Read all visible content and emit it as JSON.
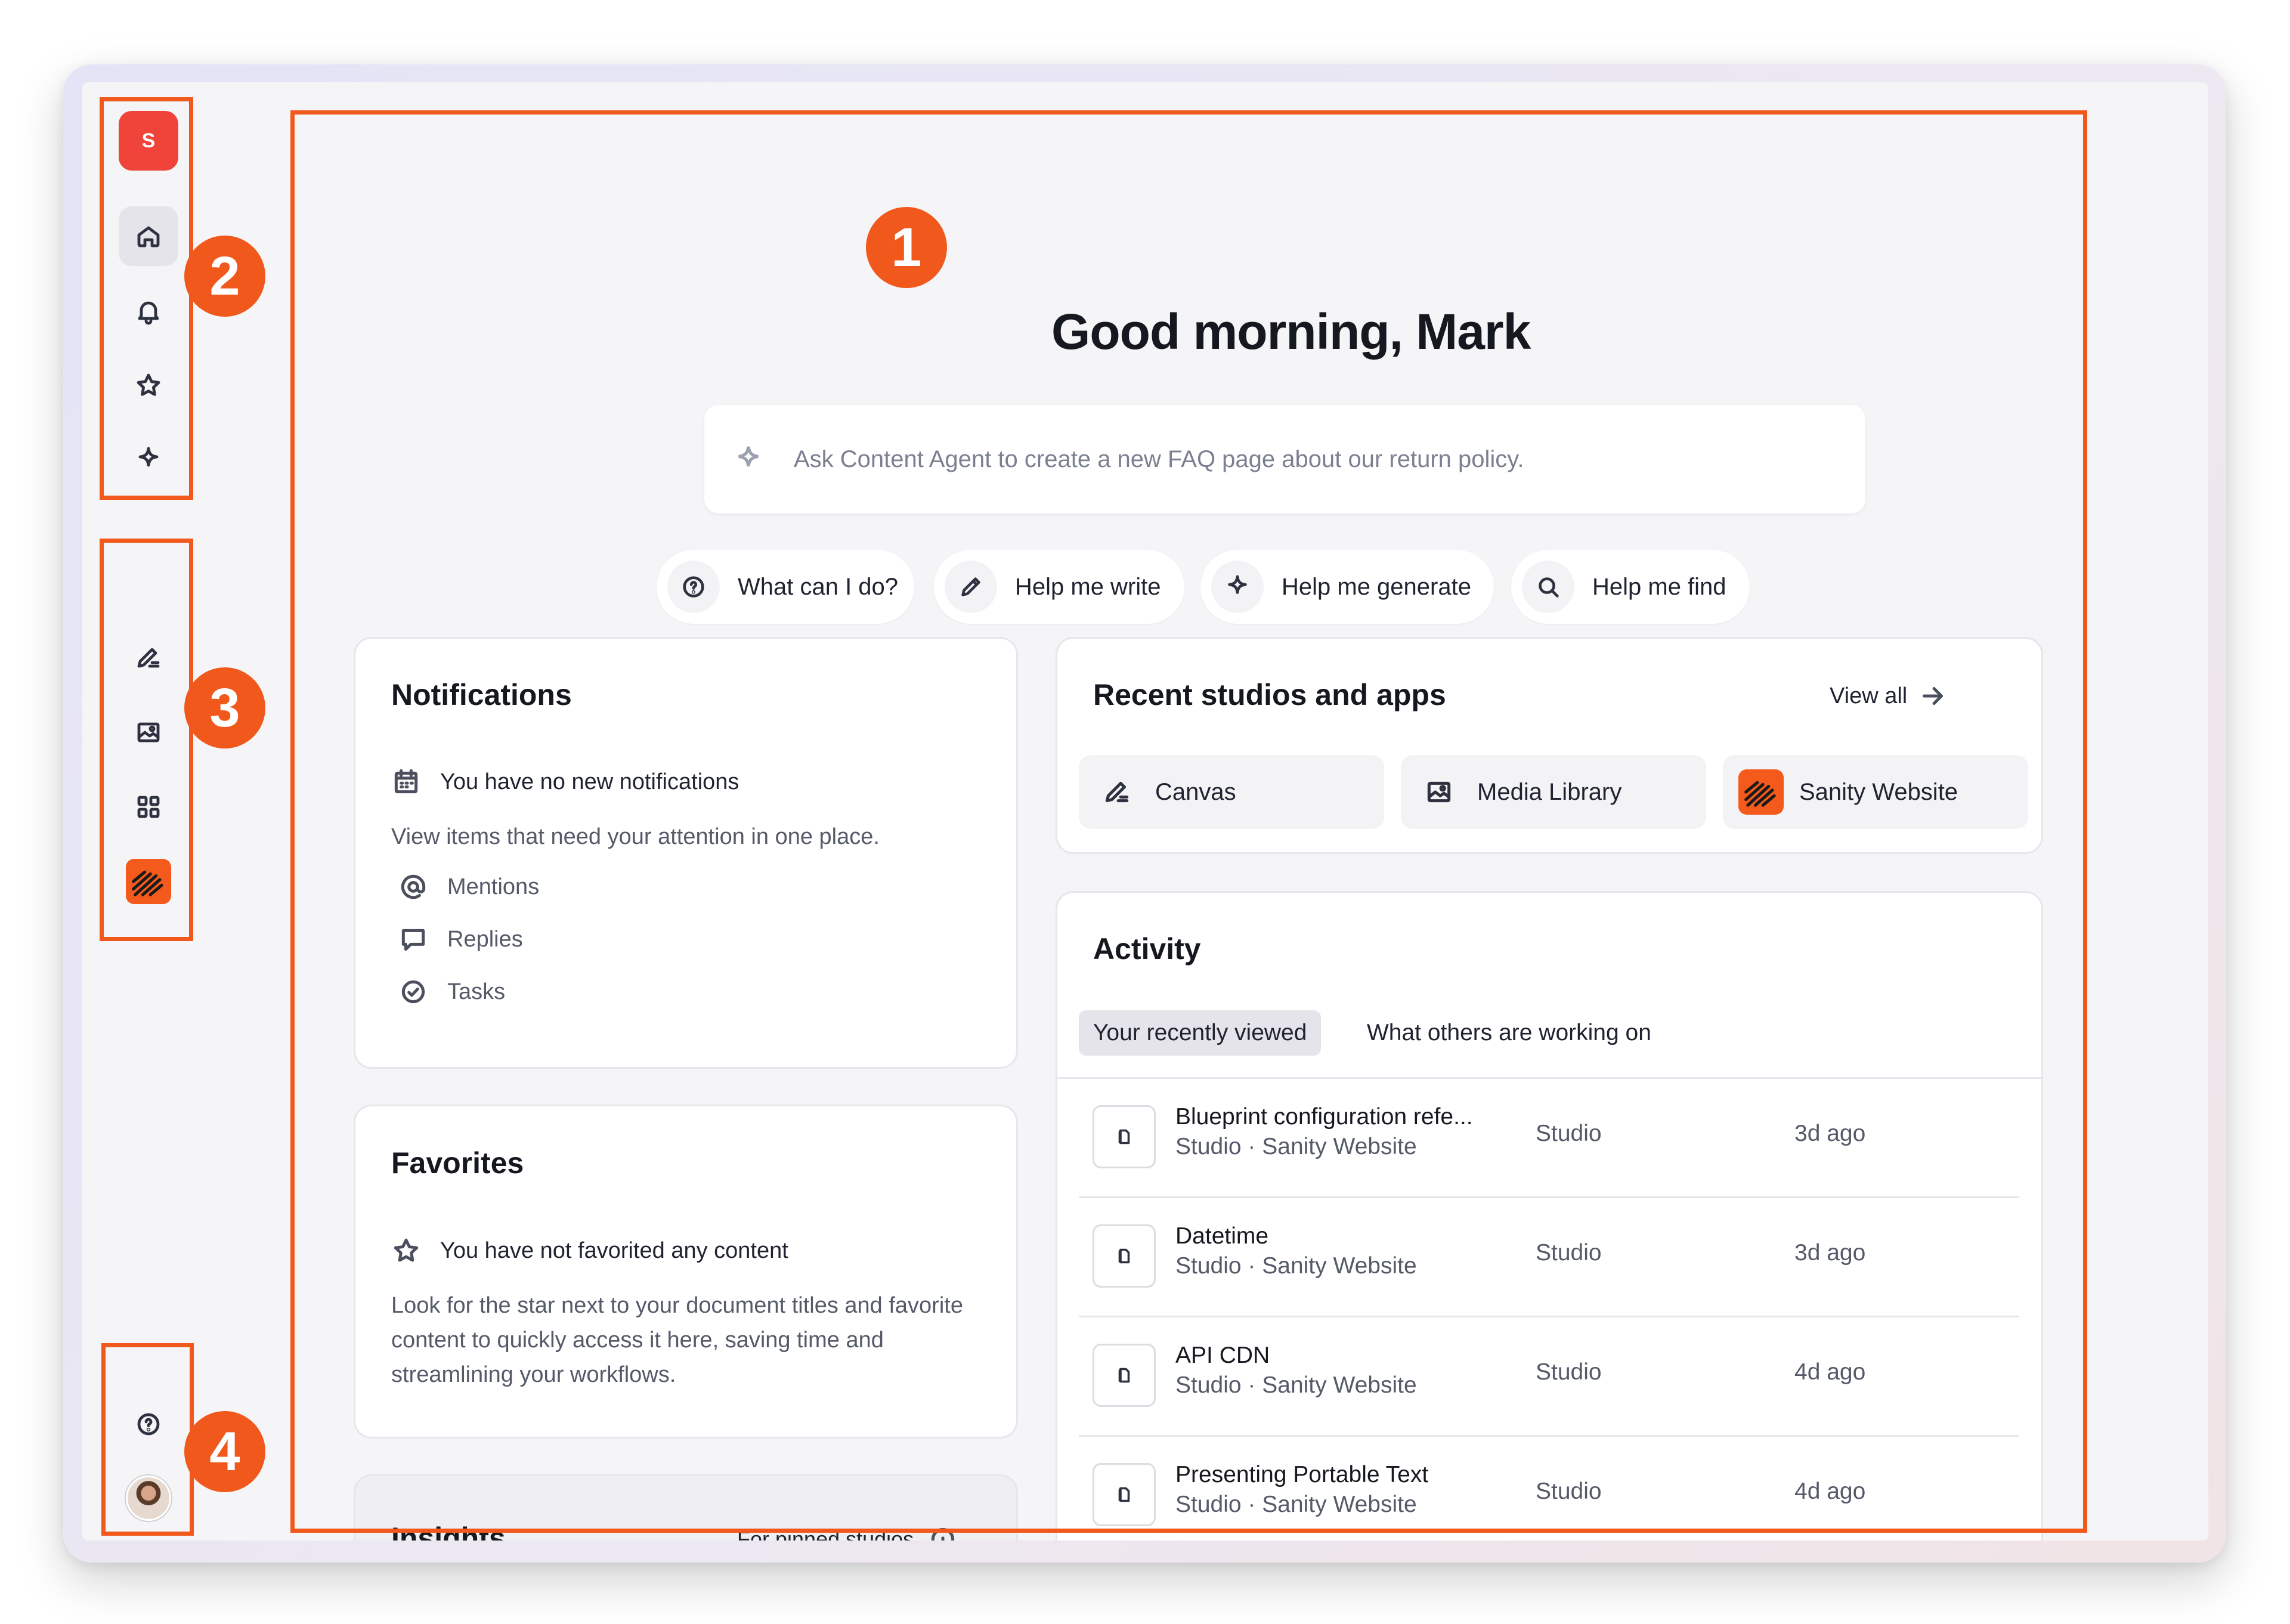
{
  "sidebar": {
    "logo_letter": "S",
    "nav_icons": [
      "home-icon",
      "bell-icon",
      "star-icon",
      "sparkle-icon"
    ],
    "app_icons": [
      "canvas-icon",
      "media-library-icon",
      "apps-grid-icon",
      "sanity-website-icon"
    ],
    "bottom_icons": [
      "help-icon",
      "avatar"
    ]
  },
  "annotations": {
    "badge_1": "1",
    "badge_2": "2",
    "badge_3": "3",
    "badge_4": "4",
    "accent_color": "#f0581c"
  },
  "main": {
    "greeting": "Good morning, Mark",
    "prompt_placeholder": "Ask Content Agent to create a new FAQ page about our return policy.",
    "chips": [
      {
        "label": "What can I do?",
        "icon": "question-icon"
      },
      {
        "label": "Help me write",
        "icon": "pencil-icon"
      },
      {
        "label": "Help me generate",
        "icon": "sparkle-icon"
      },
      {
        "label": "Help me find",
        "icon": "search-icon"
      }
    ]
  },
  "notifications": {
    "title": "Notifications",
    "empty_text": "You have no new notifications",
    "description": "View items that need your attention in one place.",
    "items": [
      "Mentions",
      "Replies",
      "Tasks"
    ]
  },
  "favorites": {
    "title": "Favorites",
    "empty_text": "You have not favorited any content",
    "description": "Look for the star next to your document titles and favorite content to quickly access it here, saving time and streamlining your workflows."
  },
  "insights": {
    "title": "Insights",
    "filter": "For pinned studios"
  },
  "recent": {
    "title": "Recent studios and apps",
    "view_all": "View all",
    "apps": [
      "Canvas",
      "Media Library",
      "Sanity Website"
    ]
  },
  "activity": {
    "title": "Activity",
    "tabs": [
      "Your recently viewed",
      "What others are working on"
    ],
    "rows": [
      {
        "title": "Blueprint configuration refe...",
        "subtitle": "Studio · Sanity Website",
        "type": "Studio",
        "time": "3d ago"
      },
      {
        "title": "Datetime",
        "subtitle": "Studio · Sanity Website",
        "type": "Studio",
        "time": "3d ago"
      },
      {
        "title": "API CDN",
        "subtitle": "Studio · Sanity Website",
        "type": "Studio",
        "time": "4d ago"
      },
      {
        "title": "Presenting Portable Text",
        "subtitle": "Studio · Sanity Website",
        "type": "Studio",
        "time": "4d ago"
      }
    ]
  }
}
